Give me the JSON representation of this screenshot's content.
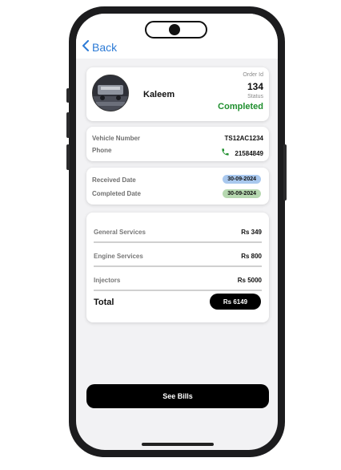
{
  "nav": {
    "back_label": "Back"
  },
  "customer": {
    "name": "Kaleem"
  },
  "order": {
    "id_label": "Order Id",
    "id": "134",
    "status_label": "Status",
    "status": "Completed",
    "status_color": "#1f8f2e"
  },
  "vehicle": {
    "number_label": "Vehicle Number",
    "number": "TS12AC1234",
    "phone_label": "Phone",
    "phone": "21584849"
  },
  "dates": {
    "received_label": "Received Date",
    "received": "30-09-2024",
    "completed_label": "Completed Date",
    "completed": "30-09-2024"
  },
  "services": [
    {
      "label": "General Services",
      "amount": "Rs 349"
    },
    {
      "label": "Engine Services",
      "amount": "Rs 800"
    },
    {
      "label": "Injectors",
      "amount": "Rs 5000"
    }
  ],
  "total": {
    "label": "Total",
    "amount": "Rs 6149"
  },
  "actions": {
    "see_bills": "See Bills"
  },
  "colors": {
    "accent": "#2d7bd6",
    "received_pill": "#a9c8ee",
    "completed_pill": "#b6d8b0"
  },
  "icons": {
    "back": "chevron-left-icon",
    "phone": "phone-icon"
  }
}
